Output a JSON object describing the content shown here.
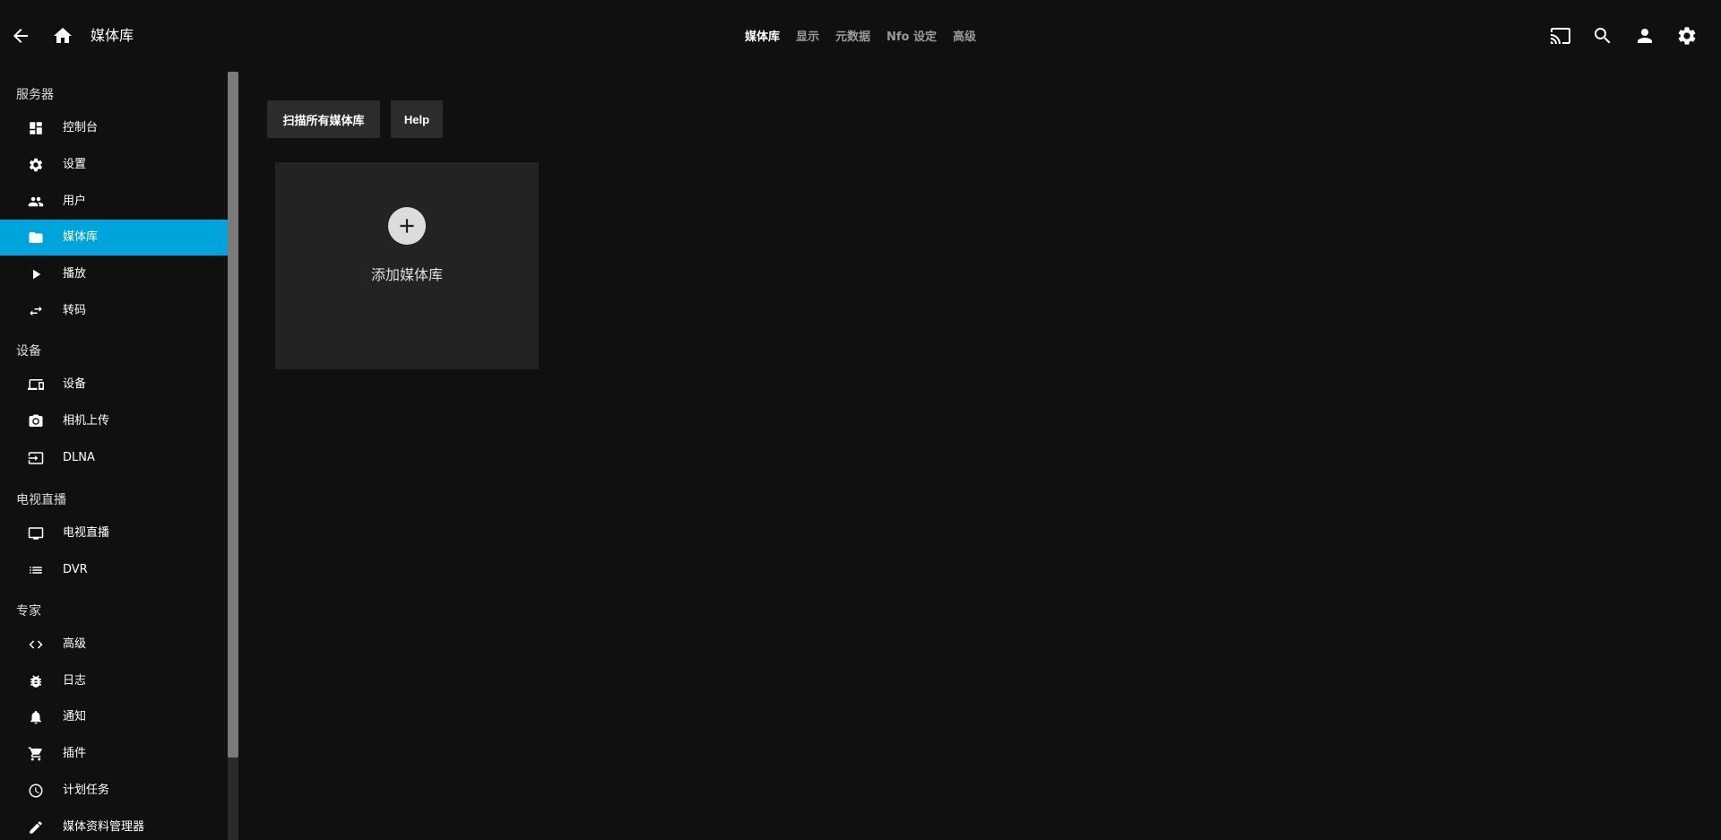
{
  "header": {
    "title": "媒体库",
    "tabs": [
      {
        "label": "媒体库",
        "active": true
      },
      {
        "label": "显示",
        "active": false
      },
      {
        "label": "元数据",
        "active": false
      },
      {
        "label": "Nfo 设定",
        "active": false
      },
      {
        "label": "高级",
        "active": false
      }
    ],
    "icons": [
      "back-arrow-icon",
      "home-icon",
      "cast-icon",
      "search-icon",
      "user-icon",
      "settings-gear-icon"
    ]
  },
  "sidebar": {
    "sections": [
      {
        "title": "服务器",
        "items": [
          {
            "label": "控制台",
            "icon": "dashboard-icon"
          },
          {
            "label": "设置",
            "icon": "gear-icon"
          },
          {
            "label": "用户",
            "icon": "people-icon"
          },
          {
            "label": "媒体库",
            "icon": "folder-icon",
            "active": true
          },
          {
            "label": "播放",
            "icon": "play-icon"
          },
          {
            "label": "转码",
            "icon": "swap-icon"
          }
        ]
      },
      {
        "title": "设备",
        "items": [
          {
            "label": "设备",
            "icon": "devices-icon"
          },
          {
            "label": "相机上传",
            "icon": "camera-icon"
          },
          {
            "label": "DLNA",
            "icon": "input-icon"
          }
        ]
      },
      {
        "title": "电视直播",
        "items": [
          {
            "label": "电视直播",
            "icon": "tv-icon"
          },
          {
            "label": "DVR",
            "icon": "list-icon"
          }
        ]
      },
      {
        "title": "专家",
        "items": [
          {
            "label": "高级",
            "icon": "code-icon"
          },
          {
            "label": "日志",
            "icon": "bug-icon"
          },
          {
            "label": "通知",
            "icon": "bell-icon"
          },
          {
            "label": "插件",
            "icon": "cart-icon"
          },
          {
            "label": "计划任务",
            "icon": "clock-icon"
          },
          {
            "label": "媒体资料管理器",
            "icon": "pencil-icon"
          }
        ]
      }
    ]
  },
  "main": {
    "scan_button": "扫描所有媒体库",
    "help_button": "Help",
    "add_library_label": "添加媒体库"
  },
  "colors": {
    "background": "#101010",
    "accent": "#00a4dc",
    "card": "#232323",
    "button": "#2c2c2c"
  }
}
